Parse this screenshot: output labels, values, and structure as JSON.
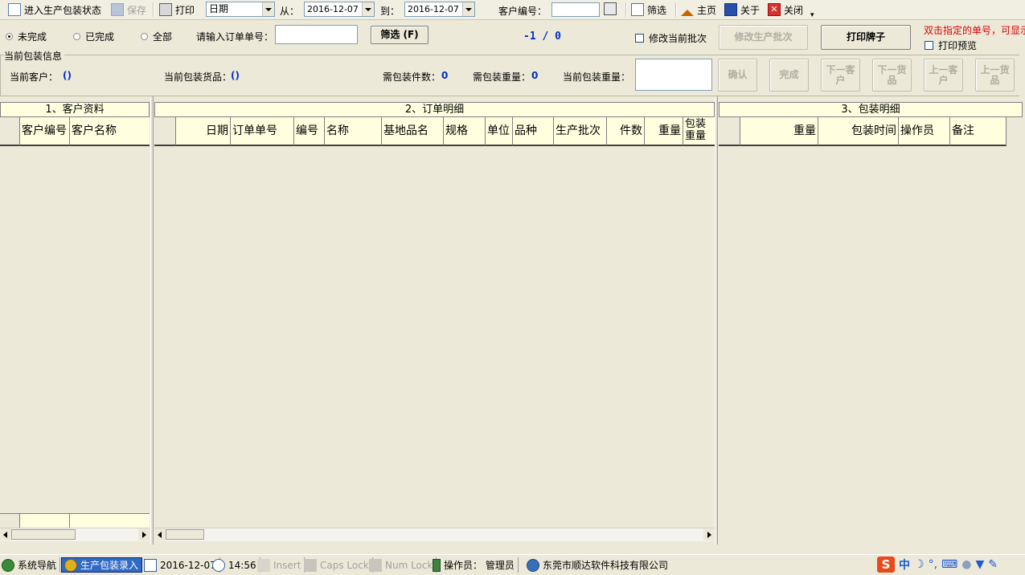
{
  "toolbar": {
    "enter_status_label": "进入生产包装状态",
    "save_label": "保存",
    "print_label": "打印",
    "date_field_value": "日期",
    "from_label": "从：",
    "from_date": "2016-12-07",
    "to_label": "到：",
    "to_date": "2016-12-07",
    "customer_no_label": "客户编号：",
    "customer_no_value": "",
    "filter_label": "筛选",
    "home_label": "主页",
    "about_label": "关于",
    "close_label": "关闭"
  },
  "filter_row": {
    "radio_incomplete": "未完成",
    "radio_complete": "已完成",
    "radio_all": "全部",
    "selected": "未完成",
    "order_input_label": "请输入订单单号：",
    "order_input_value": "",
    "filter_button": "筛选 (F)",
    "counter": "-1 / 0",
    "modify_batch_checkbox": "修改当前批次",
    "modify_batch_button": "修改生产批次",
    "print_tag_button": "打印牌子",
    "hint_text": "双击指定的单号，可显示",
    "print_preview_checkbox": "打印预览"
  },
  "packing_info": {
    "group_title": "当前包装信息",
    "current_customer_label": "当前客户：",
    "current_customer_value": "()",
    "current_goods_label": "当前包装货品：",
    "current_goods_value": "()",
    "need_pieces_label": "需包装件数：",
    "need_pieces_value": "0",
    "need_weight_label": "需包装重量：",
    "need_weight_value": "0",
    "current_weight_label": "当前包装重量：",
    "current_weight_value": "",
    "confirm_button": "确认",
    "finish_button": "完成",
    "next_customer_button": "下一客户",
    "next_goods_button": "下一货品",
    "prev_customer_button": "上一客户",
    "prev_goods_button": "上一货品"
  },
  "panels": {
    "customer": {
      "title": "1、客户资料",
      "columns": [
        "客户编号",
        "客户名称"
      ]
    },
    "order": {
      "title": "2、订单明细",
      "columns": [
        "日期",
        "订单单号",
        "编号",
        "名称",
        "基地品名",
        "规格",
        "单位",
        "品种",
        "生产批次",
        "件数",
        "重量",
        "包装重量"
      ]
    },
    "packing": {
      "title": "3、包装明细",
      "columns": [
        "重量",
        "包装时间",
        "操作员",
        "备注"
      ]
    }
  },
  "statusbar": {
    "nav": "系统导航",
    "active_tab": "生产包装录入",
    "date": "2016-12-07",
    "time": "14:56",
    "insert": "Insert",
    "caps": "Caps Lock",
    "num": "Num Lock",
    "operator": "操作员：  管理员",
    "company": "东莞市顺达软件科技有限公司"
  },
  "tray": {
    "ime_logo": "S",
    "ime_lang": "中"
  }
}
